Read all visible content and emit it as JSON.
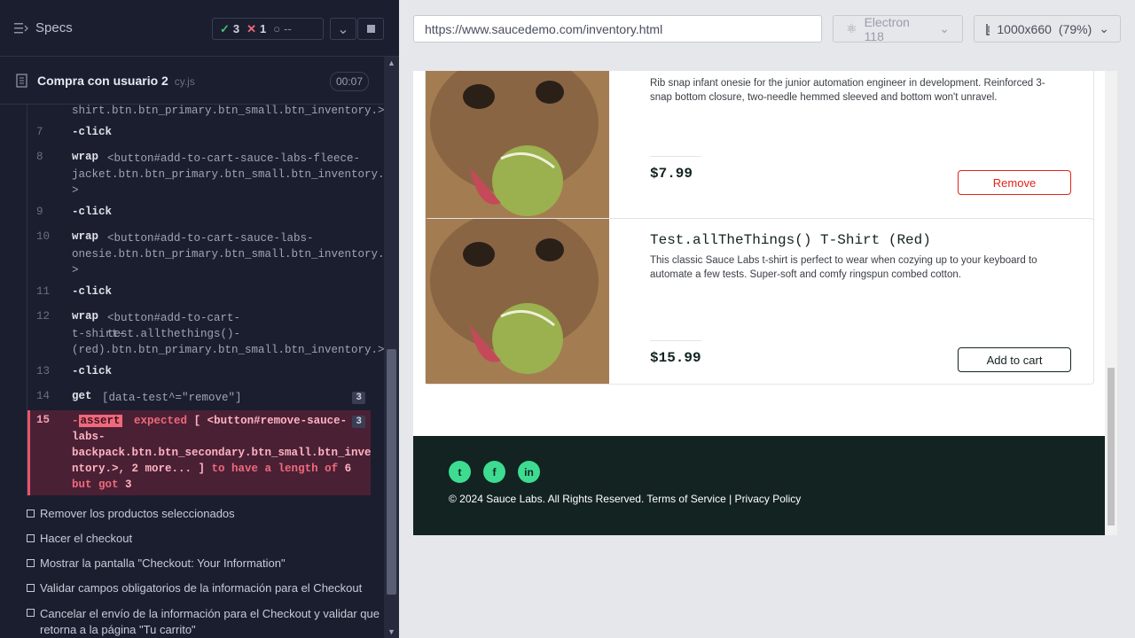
{
  "specs_label": "Specs",
  "stats": {
    "passed": "3",
    "failed": "1",
    "pending": "--"
  },
  "run": {
    "title": "Compra con usuario 2",
    "file": "cy.js",
    "time": "00:07"
  },
  "commands": [
    {
      "num": "",
      "name": "",
      "msg": "shirt.btn.btn_primary.btn_small.btn_inventory.>"
    },
    {
      "num": "7",
      "name": "-click",
      "msg": ""
    },
    {
      "num": "8",
      "name": "wrap",
      "msg": "<button#add-to-cart-sauce-labs-fleece-",
      "cont": [
        "jacket.btn.btn_primary.btn_small.btn_inventory.",
        ">"
      ]
    },
    {
      "num": "9",
      "name": "-click",
      "msg": ""
    },
    {
      "num": "10",
      "name": "wrap",
      "msg": "<button#add-to-cart-sauce-labs-",
      "cont": [
        "onesie.btn.btn_primary.btn_small.btn_inventory.",
        ">"
      ]
    },
    {
      "num": "11",
      "name": "-click",
      "msg": ""
    },
    {
      "num": "12",
      "name": "wrap",
      "msg": "<button#add-to-cart-test.allthethings()-",
      "cont": [
        "t-shirt-",
        "(red).btn.btn_primary.btn_small.btn_inventory.>"
      ]
    },
    {
      "num": "13",
      "name": "-click",
      "msg": ""
    },
    {
      "num": "14",
      "name": "get",
      "msg": "[data-test^=\"remove\"]",
      "badge": "3"
    }
  ],
  "fail": {
    "num": "15",
    "dash": "-",
    "kw": "assert",
    "expected": "expected",
    "l1": "[ <button#remove-sauce-",
    "l2": "labs-",
    "l3": "backpack.btn.btn_secondary.btn_small.btn_inve",
    "l4a": "ntory.>, 2 more... ]",
    "l4b": "to have a length of",
    "l4c": "6",
    "l5a": "but got",
    "l5b": "3",
    "badge": "3"
  },
  "tests": [
    "Remover los productos seleccionados",
    "Hacer el checkout",
    "Mostrar la pantalla \"Checkout: Your Information\"",
    "Validar campos obligatorios de la información para el Checkout",
    "Cancelar el envío de la información para el Checkout y validar que retorna a la página \"Tu carrito\""
  ],
  "browser": {
    "url": "https://www.saucedemo.com/inventory.html",
    "name": "Electron 118",
    "viewport": "1000x660",
    "zoom": "(79%)"
  },
  "products": [
    {
      "title": "",
      "desc": "Rib snap infant onesie for the junior automation engineer in development. Reinforced 3-snap bottom closure, two-needle hemmed sleeved and bottom won't unravel.",
      "price": "$7.99",
      "button": "Remove"
    },
    {
      "title": "Test.allTheThings() T-Shirt (Red)",
      "desc": "This classic Sauce Labs t-shirt is perfect to wear when cozying up to your keyboard to automate a few tests. Super-soft and comfy ringspun combed cotton.",
      "price": "$15.99",
      "button": "Add to cart"
    }
  ],
  "footer": {
    "copyright": "© 2024 Sauce Labs. All Rights Reserved. Terms of Service | Privacy Policy"
  },
  "colors": {
    "accent": "#3ddc91",
    "fail": "#f0697a",
    "footer_bg": "#132322",
    "remove": "#e2231a"
  }
}
